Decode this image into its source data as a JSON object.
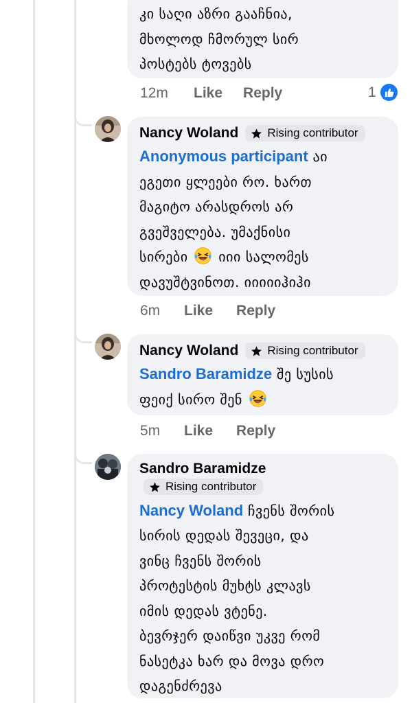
{
  "comments": [
    {
      "text_lines": [
        "კი საღი აზრი გააჩნია,",
        "მხოლოდ ჩმორულ სირ",
        "პოსტებს ტოვებს"
      ],
      "time": "12m",
      "like_label": "Like",
      "reply_label": "Reply",
      "reaction_count": "1",
      "reaction_icon": "like-reaction-icon"
    },
    {
      "author": "Nancy Woland",
      "badge": "Rising contributor",
      "mention": "Anonymous participant",
      "text_lines": [
        "აი",
        "ეგეთი ყლეები რო. ხართ",
        "მაგიტო არასდროს არ",
        "გვეშველება. უმაქნისი",
        "სირები",
        "იიი სალომეს",
        "დავუშტვინოთ. იიიიიჰიჰი"
      ],
      "time": "6m",
      "like_label": "Like",
      "reply_label": "Reply"
    },
    {
      "author": "Nancy Woland",
      "badge": "Rising contributor",
      "mention": "Sandro Baramidze",
      "text_lines": [
        "შე სუსის",
        "ფეიქ სირო შენ"
      ],
      "time": "5m",
      "like_label": "Like",
      "reply_label": "Reply"
    },
    {
      "author": "Sandro Baramidze",
      "badge": "Rising contributor",
      "mention": "Nancy Woland",
      "text_lines": [
        "ჩვენს შორის",
        "სირის დედას შევეცი, და",
        "ვინც ჩვენს შორის",
        "პროტესტის მუხტს კლავს",
        "იმის დედას ვტენე.",
        "ბევრჯერ დაიწვი უკვე რომ",
        "ნასეტკა ხარ და მოვა დრო",
        "დაგენძრევა"
      ]
    }
  ],
  "colors": {
    "mention": "#1b6ed0",
    "bubble": "#f0f2f5",
    "muted": "#65676b",
    "like_blue": "#1877f2"
  }
}
